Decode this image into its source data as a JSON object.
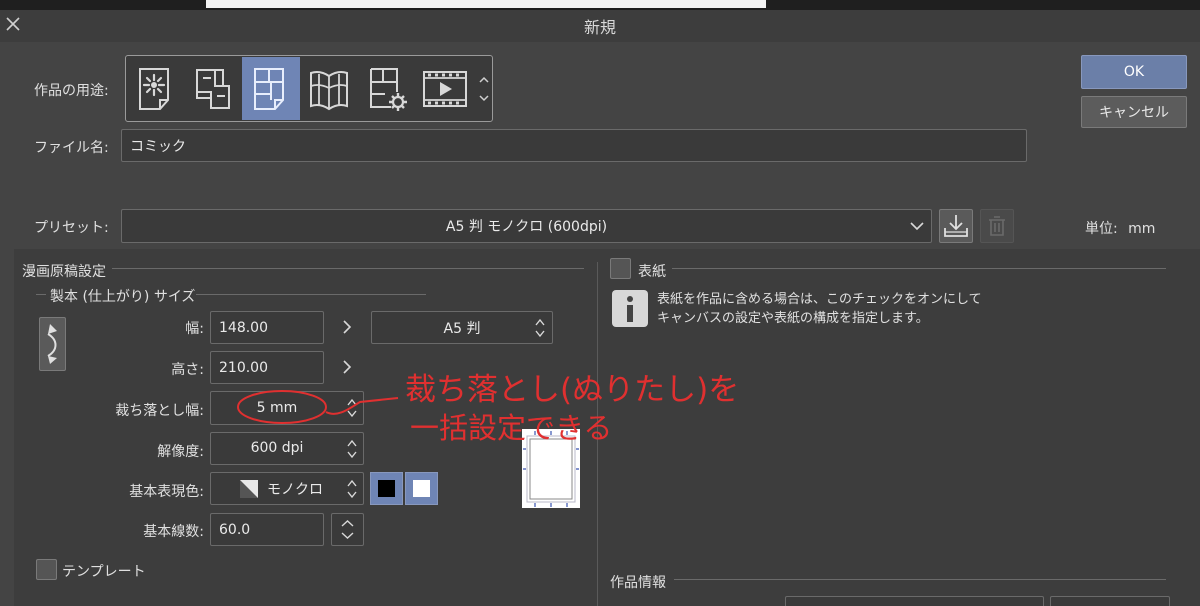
{
  "window": {
    "title": "新規"
  },
  "buttons": {
    "ok": "OK",
    "cancel": "キャンセル"
  },
  "usage": {
    "label": "作品の用途:",
    "selected_index": 2
  },
  "file": {
    "label": "ファイル名:",
    "value": "コミック"
  },
  "preset": {
    "label": "プリセット:",
    "value": "A5 判 モノクロ (600dpi)"
  },
  "unit": {
    "label": "単位:",
    "value": "mm"
  },
  "manga": {
    "section_title": "漫画原稿設定",
    "size_title": "製本 (仕上がり) サイズ",
    "width_label": "幅:",
    "width_value": "148.00",
    "height_label": "高さ:",
    "height_value": "210.00",
    "paper_size": "A5 判",
    "bleed_label": "裁ち落とし幅:",
    "bleed_value": "5 mm",
    "resolution_label": "解像度:",
    "resolution_value": "600 dpi",
    "color_label": "基本表現色:",
    "color_value": "モノクロ",
    "lines_label": "基本線数:",
    "lines_value": "60.0",
    "template_label": "テンプレート"
  },
  "cover": {
    "label": "表紙",
    "info_line1": "表紙を作品に含める場合は、このチェックをオンにして",
    "info_line2": "キャンバスの設定や表紙の構成を指定します。"
  },
  "work_info": {
    "title": "作品情報"
  },
  "annotation": {
    "line1": "裁ち落とし(ぬりたし)を",
    "line2": "一括設定できる",
    "color": "#e03030"
  },
  "colors": {
    "accent": "#6f85b5",
    "ok_button": "#6b7fa8"
  }
}
